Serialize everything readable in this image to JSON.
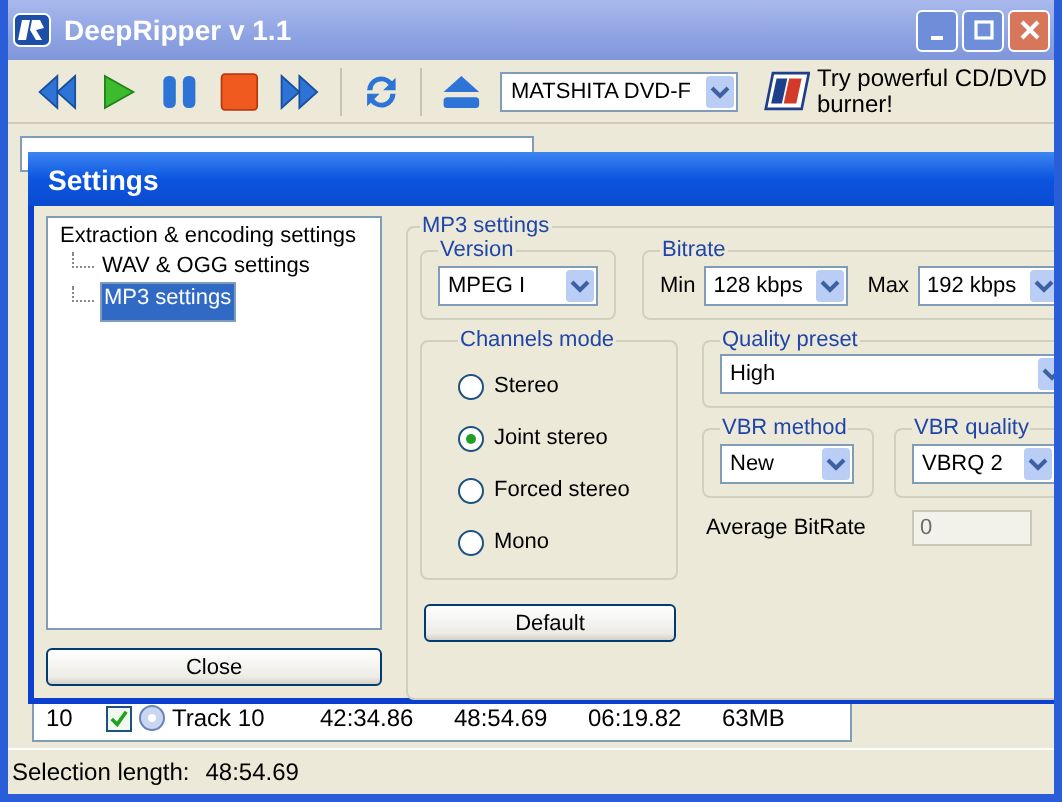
{
  "window": {
    "title": "DeepRipper v 1.1"
  },
  "toolbar": {
    "drive": "MATSHITA DVD-F",
    "promo": "Try powerful CD/DVD burner!"
  },
  "tracks": [
    {
      "number": "10",
      "checked": true,
      "title": "Track 10",
      "column_4": "42:34.86",
      "column_5": "48:54.69",
      "column_6": "06:19.82",
      "column_7": "63MB"
    }
  ],
  "status_bar": {
    "label": "Selection length:",
    "value": "48:54.69"
  },
  "settings": {
    "title": "Settings",
    "tree": [
      {
        "label": "Extraction & encoding settings",
        "selected": false,
        "children": [
          {
            "label": "WAV & OGG settings",
            "selected": false
          },
          {
            "label": "MP3 settings",
            "selected": true
          }
        ]
      }
    ],
    "close": "Close",
    "panel_title": "MP3 settings",
    "version": {
      "label": "Version",
      "value": "MPEG I"
    },
    "bitrate": {
      "label": "Bitrate",
      "min_label": "Min",
      "min": "128 kbps",
      "max_label": "Max",
      "max": "192 kbps"
    },
    "channels": {
      "label": "Channels mode",
      "options": [
        {
          "label": "Stereo",
          "selected": false
        },
        {
          "label": "Joint stereo",
          "selected": true
        },
        {
          "label": "Forced stereo",
          "selected": false
        },
        {
          "label": "Mono",
          "selected": false
        }
      ]
    },
    "quality_preset": {
      "label": "Quality preset",
      "value": "High"
    },
    "vbr_method": {
      "label": "VBR method",
      "value": "New"
    },
    "vbr_quality": {
      "label": "VBR quality",
      "value": "VBRQ 2"
    },
    "average_bitrate": {
      "label": "Average BitRate",
      "value": "0"
    },
    "default": "Default"
  }
}
